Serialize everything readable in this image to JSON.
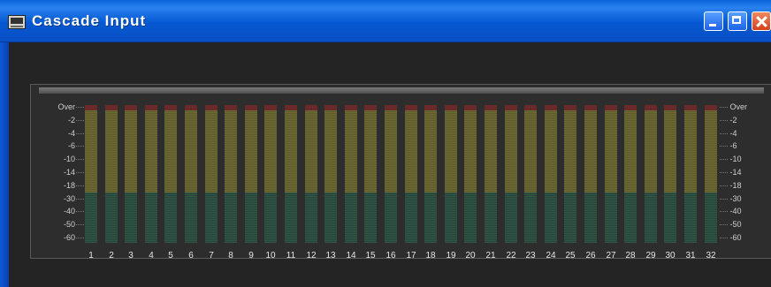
{
  "window": {
    "title": "Cascade Input",
    "buttons": [
      "minimize",
      "maximize",
      "close"
    ],
    "titlebar_color": "#0a5ed6"
  },
  "meter": {
    "scale_labels": [
      "Over",
      "-2",
      "-4",
      "-6",
      "-10",
      "-14",
      "-18",
      "-30",
      "-40",
      "-50",
      "-60"
    ],
    "channels": [
      "1",
      "2",
      "3",
      "4",
      "5",
      "6",
      "7",
      "8",
      "9",
      "10",
      "11",
      "12",
      "13",
      "14",
      "15",
      "16",
      "17",
      "18",
      "19",
      "20",
      "21",
      "22",
      "23",
      "24",
      "25",
      "26",
      "27",
      "28",
      "29",
      "30",
      "31",
      "32"
    ],
    "colors": {
      "over": "#6a2a2a",
      "high_segment": "#6e6a35",
      "low_segment": "#315648",
      "background": "#2d2d2d"
    }
  }
}
